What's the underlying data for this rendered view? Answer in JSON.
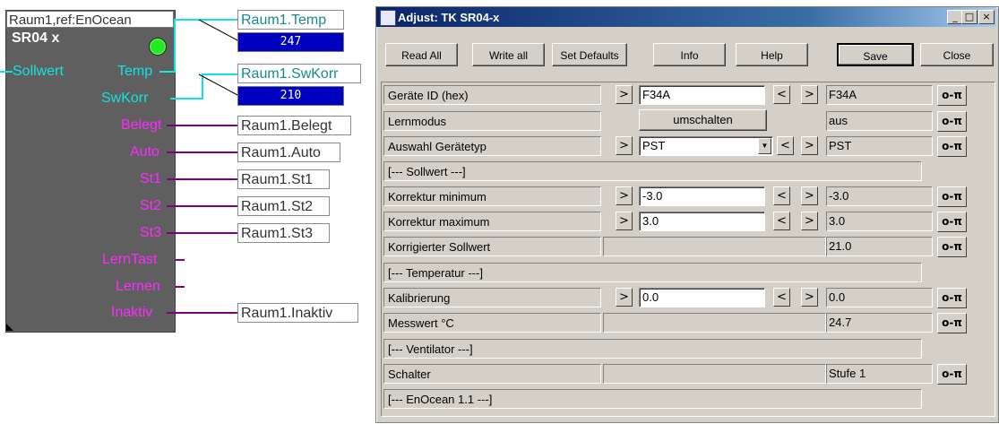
{
  "function_block": {
    "title": "Raum1,ref:EnOcean",
    "name": "SR04 x",
    "led_color": "#25e825",
    "inputs": [
      {
        "label": "Sollwert"
      }
    ],
    "outputs": [
      {
        "label": "Temp",
        "target": "Raum1.Temp",
        "value": "247"
      },
      {
        "label": "SwKorr",
        "target": "Raum1.SwKorr",
        "value": "210"
      },
      {
        "label": "Belegt",
        "target": "Raum1.Belegt"
      },
      {
        "label": "Auto",
        "target": "Raum1.Auto"
      },
      {
        "label": "St1",
        "target": "Raum1.St1"
      },
      {
        "label": "St2",
        "target": "Raum1.St2"
      },
      {
        "label": "St3",
        "target": "Raum1.St3"
      },
      {
        "label": "LernTast"
      },
      {
        "label": "Lernen"
      },
      {
        "label": "Inaktiv",
        "target": "Raum1.Inaktiv"
      }
    ]
  },
  "window": {
    "title": "Adjust: TK SR04-x",
    "caption_buttons": {
      "minimize": "_",
      "maximize": "□",
      "close": "×"
    },
    "toolbar": {
      "read_all": "Read All",
      "write_all": "Write all",
      "set_defaults": "Set Defaults",
      "info": "Info",
      "help": "Help",
      "save": "Save",
      "close": "Close"
    },
    "rows": [
      {
        "label": "Geräte ID (hex)",
        "input": "F34A",
        "value": "F34A"
      },
      {
        "label": "Lernmodus",
        "button": "umschalten",
        "value": "aus"
      },
      {
        "label": "Auswahl Gerätetyp",
        "select": "PST",
        "value": "PST"
      },
      {
        "label": "[--- Sollwert ---]"
      },
      {
        "label": "Korrektur minimum",
        "input": "-3.0",
        "value": "-3.0"
      },
      {
        "label": "Korrektur maximum",
        "input": "3.0",
        "value": "3.0"
      },
      {
        "label": "Korrigierter Sollwert",
        "value": "21.0"
      },
      {
        "label": "[--- Temperatur ---]"
      },
      {
        "label": "Kalibrierung",
        "input": "0.0",
        "value": "0.0"
      },
      {
        "label": "Messwert °C",
        "value": "24.7"
      },
      {
        "label": "[--- Ventilator ---]"
      },
      {
        "label": "Schalter",
        "value": "Stufe 1"
      },
      {
        "label": "[--- EnOcean 1.1 ---]"
      }
    ],
    "glyphs": {
      "next": ">",
      "prev": "<",
      "key": "o-π",
      "dropdown": "▼"
    }
  },
  "colors": {
    "accent_cyan": "#13e3e3",
    "accent_magenta": "#ff2bff",
    "value_blue": "#0000c0",
    "wire_purple": "#800080"
  }
}
